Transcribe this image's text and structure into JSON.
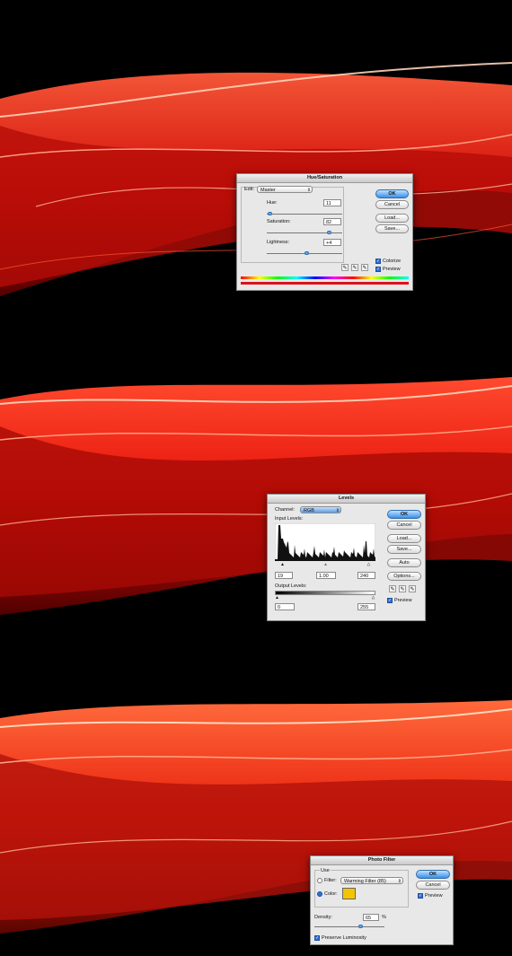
{
  "hue_saturation": {
    "title": "Hue/Saturation",
    "edit_label": "Edit:",
    "edit_value": "Master",
    "hue_label": "Hue:",
    "hue_value": "11",
    "saturation_label": "Saturation:",
    "saturation_value": "82",
    "lightness_label": "Lightness:",
    "lightness_value": "+4",
    "ok_label": "OK",
    "cancel_label": "Cancel",
    "load_label": "Load...",
    "save_label": "Save...",
    "colorize_label": "Colorize",
    "preview_label": "Preview",
    "colorize_checked": true,
    "preview_checked": true,
    "hue_slider_level": 0.03,
    "saturation_slider_level": 0.82,
    "lightness_slider_level": 0.52
  },
  "levels": {
    "title": "Levels",
    "channel_label": "Channel:",
    "channel_value": "RGB",
    "input_levels_label": "Input Levels:",
    "input_black": "19",
    "input_gamma": "1.00",
    "input_white": "240",
    "output_levels_label": "Output Levels:",
    "output_black": "0",
    "output_white": "255",
    "ok_label": "OK",
    "cancel_label": "Cancel",
    "load_label": "Load...",
    "save_label": "Save...",
    "auto_label": "Auto",
    "options_label": "Options...",
    "preview_label": "Preview",
    "preview_checked": true
  },
  "photo_filter": {
    "title": "Photo Filter",
    "use_label": "Use",
    "filter_label": "Filter:",
    "filter_value": "Warming Filter (85)",
    "color_label": "Color:",
    "color_swatch": "#f5c400",
    "density_label": "Density:",
    "density_value": "65",
    "density_unit": "%",
    "preserve_luminosity_label": "Preserve Luminosity",
    "ok_label": "OK",
    "cancel_label": "Cancel",
    "preview_label": "Preview",
    "preview_checked": true,
    "preserve_checked": true,
    "density_level": 0.65
  }
}
